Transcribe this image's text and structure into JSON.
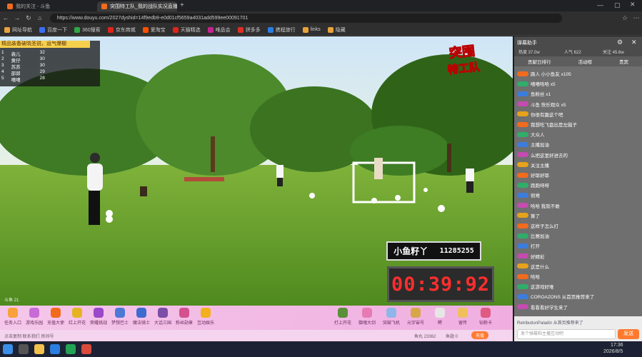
{
  "browser": {
    "tabs": [
      {
        "label": "我的关注 - 斗鱼",
        "active": false
      },
      {
        "label": "突围特工队_我的战队实况直播",
        "active": true
      }
    ],
    "url": "https://www.douyu.com/2027dyshid=14f9edb9-e0d01cf5659a4031add599ee00091701",
    "bookmarks": [
      "网址导航",
      "百度一下",
      "360搜索",
      "京东商城",
      "爱淘宝",
      "天猫精选",
      "唯品会",
      "拼多多",
      "携程旅行",
      "links",
      "隐藏"
    ]
  },
  "stream": {
    "logo_line1": "突围",
    "logo_line2": "特工队",
    "banner": "精品装备破晓圣锐，运气爆棚",
    "leaderboard": [
      {
        "rank": "1",
        "name": "裴儿",
        "score": "32"
      },
      {
        "rank": "2",
        "name": "黄仔",
        "score": "30"
      },
      {
        "rank": "3",
        "name": "苏苏",
        "score": "30"
      },
      {
        "rank": "4",
        "name": "邵郎",
        "score": "29"
      },
      {
        "rank": "5",
        "name": "嘻嘻",
        "score": "28"
      }
    ],
    "score_name": "小鱼籽丫",
    "score_value": "11285255",
    "timer": "00:39:92",
    "watermark": "斗鱼 21"
  },
  "giftbar": {
    "left_items": [
      "任务入口",
      "游戏乐园",
      "充值大使",
      "红上开花",
      "荣耀挑战",
      "梦想巴士",
      "魔法骑士",
      "大话三国",
      "粉丝勋章",
      "互动娱乐"
    ],
    "right_items": [
      "打上开花",
      "御魂大剑",
      "突破飞机",
      "元宇宙号",
      "鳄",
      "留传",
      "钻粉卡"
    ],
    "info": "点击复制 联系我们 房间号",
    "fish_balls": "鱼丸 23362",
    "fish_pay": "鱼翅 0",
    "recharge": "充值"
  },
  "chat": {
    "title": "弹幕助手",
    "stats": [
      "热度 37.0w",
      "人气 622",
      "关注 45.6w"
    ],
    "tabs": [
      "贡献日排行",
      "活动榜",
      "贵宾"
    ],
    "messages": [
      "路人 小小鱼友 x105",
      "嘻嘻哈哈 x5",
      "鱼粉丝 x1",
      "斗鱼 快乐观众 x5",
      "你很有趣这个吧",
      "我想吃飞盘出是左脑子",
      "大众人",
      "主播加油",
      "么把这里好进去的",
      "关注主播",
      "好耶好耶",
      "跑跑呀呀",
      "很难",
      "哈哈 我就不敢",
      "算了",
      "这样子怎么打",
      "比赛加油",
      "打开",
      "好精彩",
      "这是什么",
      "哈哈",
      "这游戏好难",
      "COROAZONS 从首页推荐来了",
      "看看看好学生来了",
      "RetributionPaladin 从首页推荐来了"
    ],
    "input_placeholder": "发个弹幕和主播互动吧",
    "send_label": "发送"
  },
  "taskbar": {
    "time": "17:36",
    "date": "2026/8/5"
  },
  "colors": {
    "accent": "#f26b1d",
    "chat_bg": "#6f6f6f",
    "gift_bg": "#f0aee0",
    "timer_red": "#ff2e2e"
  }
}
